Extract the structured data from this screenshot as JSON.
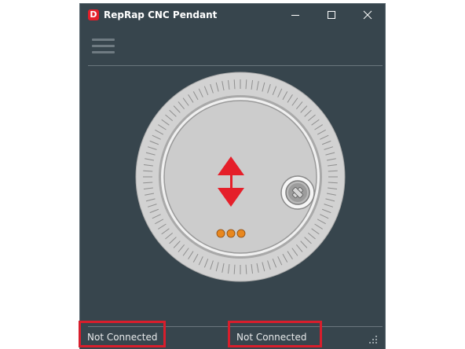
{
  "window": {
    "title": "RepRap CNC Pendant",
    "app_icon_glyph": "D",
    "buttons": {
      "minimize": "minimize-icon",
      "maximize": "maximize-icon",
      "close": "close-icon"
    }
  },
  "menu": {
    "icon": "hamburger-menu-icon"
  },
  "dial": {
    "icon": "vertical-move-arrow-icon",
    "handle_icon": "crank-handle-icon",
    "indicator_count": 3
  },
  "status": {
    "left": "Not Connected",
    "right": "Not Connected"
  },
  "colors": {
    "window_bg": "#37454d",
    "accent_red": "#e51f2a",
    "dial_gray": "#cfcfcf",
    "indicator_orange": "#e8871e",
    "highlight_red": "#d81e2c"
  }
}
